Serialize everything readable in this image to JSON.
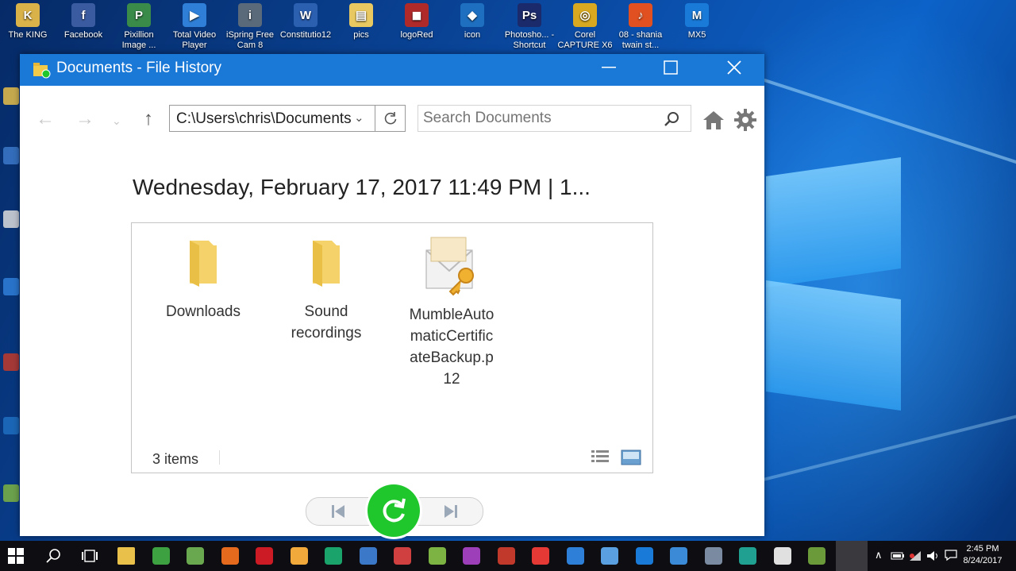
{
  "desktop": {
    "icons": [
      {
        "label": "The KING",
        "color": "#d9b24a",
        "glyph": "K"
      },
      {
        "label": "Facebook",
        "color": "#3b5ba0",
        "glyph": "f"
      },
      {
        "label": "Pixillion Image ...",
        "color": "#3a8a4a",
        "glyph": "P"
      },
      {
        "label": "Total Video Player",
        "color": "#2f7fd8",
        "glyph": "▶"
      },
      {
        "label": "iSpring Free Cam 8",
        "color": "#5a6a7a",
        "glyph": "i"
      },
      {
        "label": "Constitutio12",
        "color": "#2b5fb0",
        "glyph": "W"
      },
      {
        "label": "pics",
        "color": "#e8c860",
        "glyph": "▤"
      },
      {
        "label": "logoRed",
        "color": "#b02a2a",
        "glyph": "◼"
      },
      {
        "label": "icon",
        "color": "#1e6fc0",
        "glyph": "◆"
      },
      {
        "label": "Photosho... - Shortcut",
        "color": "#1b2a6a",
        "glyph": "Ps"
      },
      {
        "label": "Corel CAPTURE X6",
        "color": "#d8a820",
        "glyph": "◎"
      },
      {
        "label": "08 - shania twain   st...",
        "color": "#e05020",
        "glyph": "♪"
      },
      {
        "label": "MX5",
        "color": "#1a7ad8",
        "glyph": "M"
      }
    ]
  },
  "window": {
    "title": "Documents - File History",
    "address": "C:\\Users\\chris\\Documents",
    "search_placeholder": "Search Documents",
    "snapshot_label": "Wednesday, February 17, 2017 11:49 PM   |   1...",
    "items": [
      {
        "name": "Downloads",
        "type": "folder"
      },
      {
        "name": "Sound recordings",
        "type": "folder"
      },
      {
        "name": "MumbleAutomaticCertificateBackup.p12",
        "type": "certificate"
      }
    ],
    "status": "3 items"
  },
  "taskbar": {
    "time": "2:45 PM",
    "date": "8/24/2017",
    "apps": [
      {
        "name": "file-explorer",
        "color": "#e8c04a"
      },
      {
        "name": "chrome",
        "color": "#3da142"
      },
      {
        "name": "notepad",
        "color": "#6aa84f"
      },
      {
        "name": "firefox",
        "color": "#e66a1e"
      },
      {
        "name": "opera",
        "color": "#cc1b24"
      },
      {
        "name": "paint",
        "color": "#f2a93b"
      },
      {
        "name": "green-app",
        "color": "#1aa36a"
      },
      {
        "name": "blue-app",
        "color": "#3b78c8"
      },
      {
        "name": "red-app",
        "color": "#d04040"
      },
      {
        "name": "layers-app",
        "color": "#7cb342"
      },
      {
        "name": "purple-app",
        "color": "#9c3fb8"
      },
      {
        "name": "record-app",
        "color": "#c0392b"
      },
      {
        "name": "yandex",
        "color": "#e53935"
      },
      {
        "name": "a-app",
        "color": "#2d7fd8"
      },
      {
        "name": "disc-app",
        "color": "#5aa0e0"
      },
      {
        "name": "mx-app",
        "color": "#1a7ad8"
      },
      {
        "name": "globe-app",
        "color": "#3a8ad8"
      },
      {
        "name": "network-app",
        "color": "#7a8aa0"
      },
      {
        "name": "n-app",
        "color": "#20a090"
      },
      {
        "name": "photos-app",
        "color": "#e0e0e0"
      },
      {
        "name": "active-app",
        "color": "#6a9a3a"
      }
    ]
  }
}
